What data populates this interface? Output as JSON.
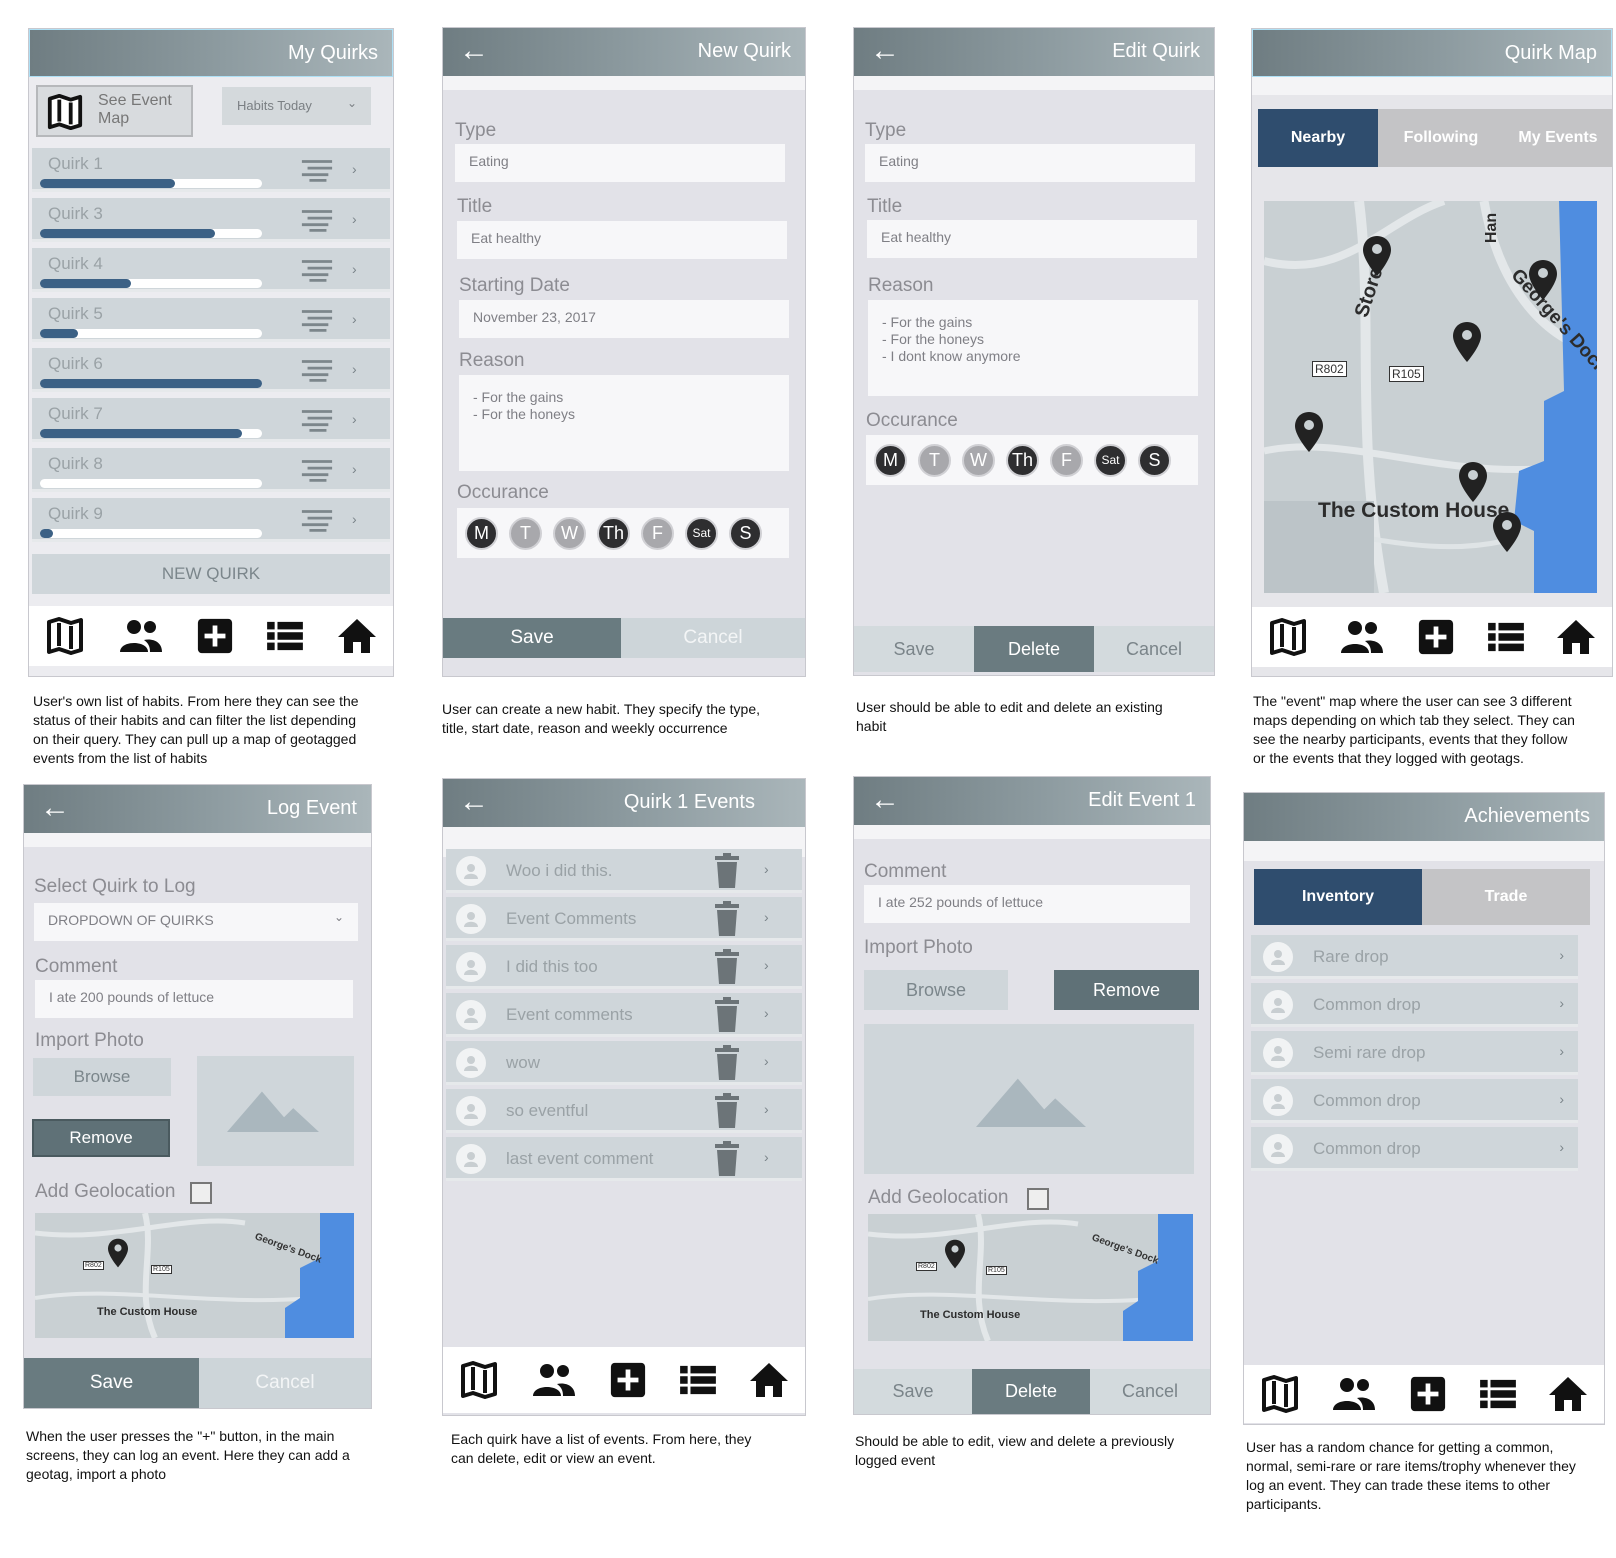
{
  "screens": {
    "my_quirks": {
      "title": "My Quirks",
      "see_event_map": "See Event Map",
      "filter": "Habits Today",
      "quirks": [
        {
          "name": "Quirk 1",
          "progress": 0.61
        },
        {
          "name": "Quirk 3",
          "progress": 0.79
        },
        {
          "name": "Quirk 4",
          "progress": 0.41
        },
        {
          "name": "Quirk 5",
          "progress": 0.17
        },
        {
          "name": "Quirk 6",
          "progress": 1.0
        },
        {
          "name": "Quirk 7",
          "progress": 0.91
        },
        {
          "name": "Quirk 8",
          "progress": 0.0
        },
        {
          "name": "Quirk 9",
          "progress": 0.06
        }
      ],
      "new_quirk": "NEW QUIRK",
      "caption": "User's own list of habits. From here they can see the status of their habits and can filter the list depending on their query. They can pull up a map of geotagged events from the list of habits"
    },
    "new_quirk": {
      "title": "New Quirk",
      "type_label": "Type",
      "type_value": "Eating",
      "title_label": "Title",
      "title_value": "Eat healthy",
      "date_label": "Starting Date",
      "date_value": "November 23, 2017",
      "reason_label": "Reason",
      "reason_lines": [
        "- For the gains",
        "- For the honeys"
      ],
      "occurance_label": "Occurance",
      "save": "Save",
      "cancel": "Cancel",
      "caption": "User can create a new habit. They specify the type, title, start date, reason and weekly occurrence"
    },
    "edit_quirk": {
      "title": "Edit Quirk",
      "type_label": "Type",
      "type_value": "Eating",
      "title_label": "Title",
      "title_value": "Eat healthy",
      "reason_label": "Reason",
      "reason_lines": [
        "- For the gains",
        "- For the honeys",
        "- I dont know anymore"
      ],
      "occurance_label": "Occurance",
      "save": "Save",
      "delete": "Delete",
      "cancel": "Cancel",
      "caption": "User should be able to edit and delete an existing habit"
    },
    "quirk_map": {
      "title": "Quirk Map",
      "tabs": [
        "Nearby",
        "Following",
        "My Events"
      ],
      "map_labels": {
        "custom_house": "The Custom House",
        "georges_dock": "George's Dock",
        "store": "Store",
        "r802": "R802",
        "r105": "R105",
        "han": "Han"
      },
      "caption": "The \"event\" map where the user can see 3 different maps depending on which tab they select. They can see the nearby participants, events that they follow or the events that they logged with geotags."
    },
    "log_event": {
      "title": "Log Event",
      "select_label": "Select Quirk to Log",
      "dropdown": "DROPDOWN OF QUIRKS",
      "comment_label": "Comment",
      "comment_value": "I ate 200 pounds of lettuce",
      "photo_label": "Import Photo",
      "browse": "Browse",
      "remove": "Remove",
      "geo_label": "Add Geolocation",
      "save": "Save",
      "cancel": "Cancel",
      "caption": "When the user presses the \"+\" button, in the main screens, they can log an event. Here they can add a geotag, import a photo"
    },
    "quirk_events": {
      "title": "Quirk 1 Events",
      "events": [
        "Woo i did this.",
        "Event Comments",
        "I did this too",
        "Event comments",
        "wow",
        "so eventful",
        "last event comment"
      ],
      "caption": "Each quirk have a list of events. From here, they can delete, edit or view an event."
    },
    "edit_event": {
      "title": "Edit Event 1",
      "comment_label": "Comment",
      "comment_value": "I ate 252 pounds of lettuce",
      "photo_label": "Import Photo",
      "browse": "Browse",
      "remove": "Remove",
      "geo_label": "Add Geolocation",
      "save": "Save",
      "delete": "Delete",
      "cancel": "Cancel",
      "caption": "Should be able to edit, view and delete a previously logged event"
    },
    "achievements": {
      "title": "Achievements",
      "tabs": [
        "Inventory",
        "Trade"
      ],
      "items": [
        "Rare drop",
        "Common drop",
        "Semi rare drop",
        "Common drop",
        "Common drop"
      ],
      "caption": "User has a random chance for getting a common, normal, semi-rare or rare items/trophy whenever they log an event. They can trade these items to other participants."
    }
  },
  "days": [
    "M",
    "T",
    "W",
    "Th",
    "F",
    "Sat",
    "S"
  ],
  "days_dark": [
    true,
    false,
    false,
    true,
    false,
    true,
    true
  ],
  "map_small_labels": {
    "custom_house": "The Custom House",
    "georges_dock": "George's Dock",
    "r802": "R802",
    "r105": "R105"
  },
  "colors": {
    "accent": "#3c6185",
    "header": "#7c8a8f",
    "tab_active": "#2f4d6e",
    "button_dark": "#5f7177"
  }
}
